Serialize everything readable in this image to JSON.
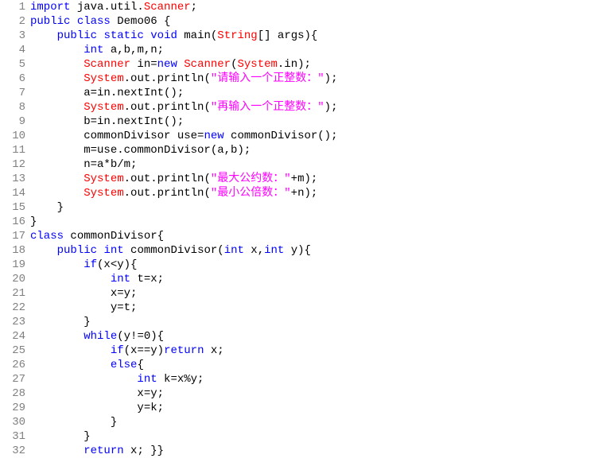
{
  "gutter": {
    "lines": [
      "1",
      "2",
      "3",
      "4",
      "5",
      "6",
      "7",
      "8",
      "9",
      "10",
      "11",
      "12",
      "13",
      "14",
      "15",
      "16",
      "17",
      "18",
      "19",
      "20",
      "21",
      "22",
      "23",
      "24",
      "25",
      "26",
      "27",
      "28",
      "29",
      "30",
      "31",
      "32"
    ]
  },
  "code": {
    "lines": [
      [
        {
          "c": "kw",
          "t": "import"
        },
        {
          "c": "id",
          "t": " java.util."
        },
        {
          "c": "type",
          "t": "Scanner"
        },
        {
          "c": "id",
          "t": ";"
        }
      ],
      [
        {
          "c": "kw",
          "t": "public"
        },
        {
          "c": "id",
          "t": " "
        },
        {
          "c": "kw",
          "t": "class"
        },
        {
          "c": "id",
          "t": " Demo06 {"
        }
      ],
      [
        {
          "c": "id",
          "t": "    "
        },
        {
          "c": "kw",
          "t": "public"
        },
        {
          "c": "id",
          "t": " "
        },
        {
          "c": "kw",
          "t": "static"
        },
        {
          "c": "id",
          "t": " "
        },
        {
          "c": "kw",
          "t": "void"
        },
        {
          "c": "id",
          "t": " main("
        },
        {
          "c": "type",
          "t": "String"
        },
        {
          "c": "id",
          "t": "[] args){"
        }
      ],
      [
        {
          "c": "id",
          "t": "        "
        },
        {
          "c": "kw",
          "t": "int"
        },
        {
          "c": "id",
          "t": " a,b,m,n;"
        }
      ],
      [
        {
          "c": "id",
          "t": "        "
        },
        {
          "c": "type",
          "t": "Scanner"
        },
        {
          "c": "id",
          "t": " in="
        },
        {
          "c": "kw",
          "t": "new"
        },
        {
          "c": "id",
          "t": " "
        },
        {
          "c": "type",
          "t": "Scanner"
        },
        {
          "c": "id",
          "t": "("
        },
        {
          "c": "type",
          "t": "System"
        },
        {
          "c": "id",
          "t": ".in);"
        }
      ],
      [
        {
          "c": "id",
          "t": "        "
        },
        {
          "c": "type",
          "t": "System"
        },
        {
          "c": "id",
          "t": ".out.println("
        },
        {
          "c": "str",
          "t": "\"请输入一个正整数：\""
        },
        {
          "c": "id",
          "t": ");"
        }
      ],
      [
        {
          "c": "id",
          "t": "        a=in.nextInt();"
        }
      ],
      [
        {
          "c": "id",
          "t": "        "
        },
        {
          "c": "type",
          "t": "System"
        },
        {
          "c": "id",
          "t": ".out.println("
        },
        {
          "c": "str",
          "t": "\"再输入一个正整数：\""
        },
        {
          "c": "id",
          "t": ");"
        }
      ],
      [
        {
          "c": "id",
          "t": "        b=in.nextInt();"
        }
      ],
      [
        {
          "c": "id",
          "t": "        commonDivisor use="
        },
        {
          "c": "kw",
          "t": "new"
        },
        {
          "c": "id",
          "t": " commonDivisor();"
        }
      ],
      [
        {
          "c": "id",
          "t": "        m=use.commonDivisor(a,b);"
        }
      ],
      [
        {
          "c": "id",
          "t": "        n=a*b/m;"
        }
      ],
      [
        {
          "c": "id",
          "t": "        "
        },
        {
          "c": "type",
          "t": "System"
        },
        {
          "c": "id",
          "t": ".out.println("
        },
        {
          "c": "str",
          "t": "\"最大公约数：\""
        },
        {
          "c": "id",
          "t": "+m);"
        }
      ],
      [
        {
          "c": "id",
          "t": "        "
        },
        {
          "c": "type",
          "t": "System"
        },
        {
          "c": "id",
          "t": ".out.println("
        },
        {
          "c": "str",
          "t": "\"最小公倍数：\""
        },
        {
          "c": "id",
          "t": "+n);"
        }
      ],
      [
        {
          "c": "id",
          "t": "    }"
        }
      ],
      [
        {
          "c": "id",
          "t": "}"
        }
      ],
      [
        {
          "c": "kw",
          "t": "class"
        },
        {
          "c": "id",
          "t": " commonDivisor{"
        }
      ],
      [
        {
          "c": "id",
          "t": "    "
        },
        {
          "c": "kw",
          "t": "public"
        },
        {
          "c": "id",
          "t": " "
        },
        {
          "c": "kw",
          "t": "int"
        },
        {
          "c": "id",
          "t": " commonDivisor("
        },
        {
          "c": "kw",
          "t": "int"
        },
        {
          "c": "id",
          "t": " x,"
        },
        {
          "c": "kw",
          "t": "int"
        },
        {
          "c": "id",
          "t": " y){"
        }
      ],
      [
        {
          "c": "id",
          "t": "        "
        },
        {
          "c": "kw",
          "t": "if"
        },
        {
          "c": "id",
          "t": "(x<y){"
        }
      ],
      [
        {
          "c": "id",
          "t": "            "
        },
        {
          "c": "kw",
          "t": "int"
        },
        {
          "c": "id",
          "t": " t=x;"
        }
      ],
      [
        {
          "c": "id",
          "t": "            x=y;"
        }
      ],
      [
        {
          "c": "id",
          "t": "            y=t;"
        }
      ],
      [
        {
          "c": "id",
          "t": "        }"
        }
      ],
      [
        {
          "c": "id",
          "t": "        "
        },
        {
          "c": "kw",
          "t": "while"
        },
        {
          "c": "id",
          "t": "(y!=0){"
        }
      ],
      [
        {
          "c": "id",
          "t": "            "
        },
        {
          "c": "kw",
          "t": "if"
        },
        {
          "c": "id",
          "t": "(x==y)"
        },
        {
          "c": "kw",
          "t": "return"
        },
        {
          "c": "id",
          "t": " x;"
        }
      ],
      [
        {
          "c": "id",
          "t": "            "
        },
        {
          "c": "kw",
          "t": "else"
        },
        {
          "c": "id",
          "t": "{"
        }
      ],
      [
        {
          "c": "id",
          "t": "                "
        },
        {
          "c": "kw",
          "t": "int"
        },
        {
          "c": "id",
          "t": " k=x%y;"
        }
      ],
      [
        {
          "c": "id",
          "t": "                x=y;"
        }
      ],
      [
        {
          "c": "id",
          "t": "                y=k;"
        }
      ],
      [
        {
          "c": "id",
          "t": "            }"
        }
      ],
      [
        {
          "c": "id",
          "t": "        }"
        }
      ],
      [
        {
          "c": "id",
          "t": "        "
        },
        {
          "c": "kw",
          "t": "return"
        },
        {
          "c": "id",
          "t": " x; }}"
        }
      ]
    ]
  }
}
